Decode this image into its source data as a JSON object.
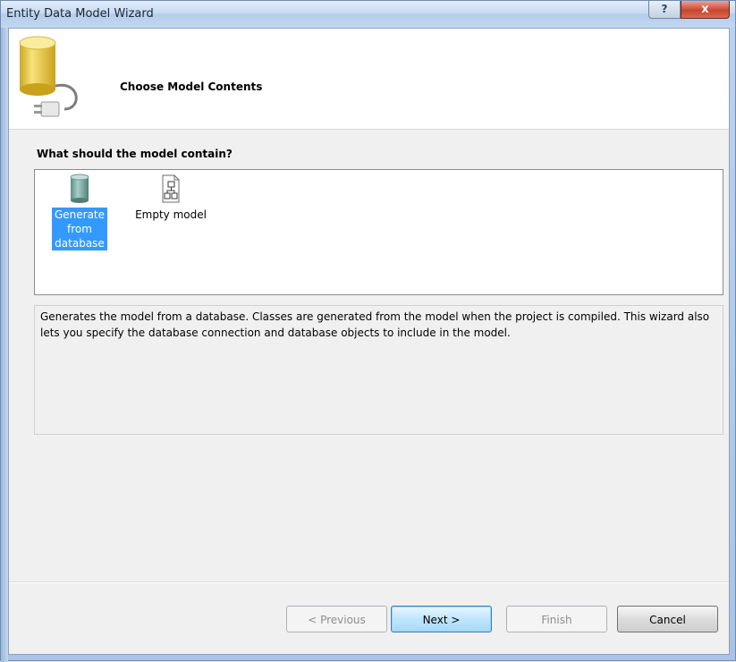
{
  "window": {
    "title": "Entity Data Model Wizard",
    "help_label": "?",
    "close_label": "x"
  },
  "header": {
    "title": "Choose Model Contents",
    "icon": "database-plug-icon"
  },
  "question": "What should the model contain?",
  "choices": [
    {
      "label": "Generate from database",
      "icon": "database-icon",
      "selected": true
    },
    {
      "label": "Empty model",
      "icon": "diagram-icon",
      "selected": false
    }
  ],
  "description": "Generates the model from a database. Classes are generated from the model when the project is compiled. This wizard also lets you specify the database connection and database objects to include in the model.",
  "buttons": {
    "previous": "< Previous",
    "next": "Next >",
    "finish": "Finish",
    "cancel": "Cancel"
  },
  "colors": {
    "selection": "#3399ff",
    "close_button": "#c7462f"
  }
}
